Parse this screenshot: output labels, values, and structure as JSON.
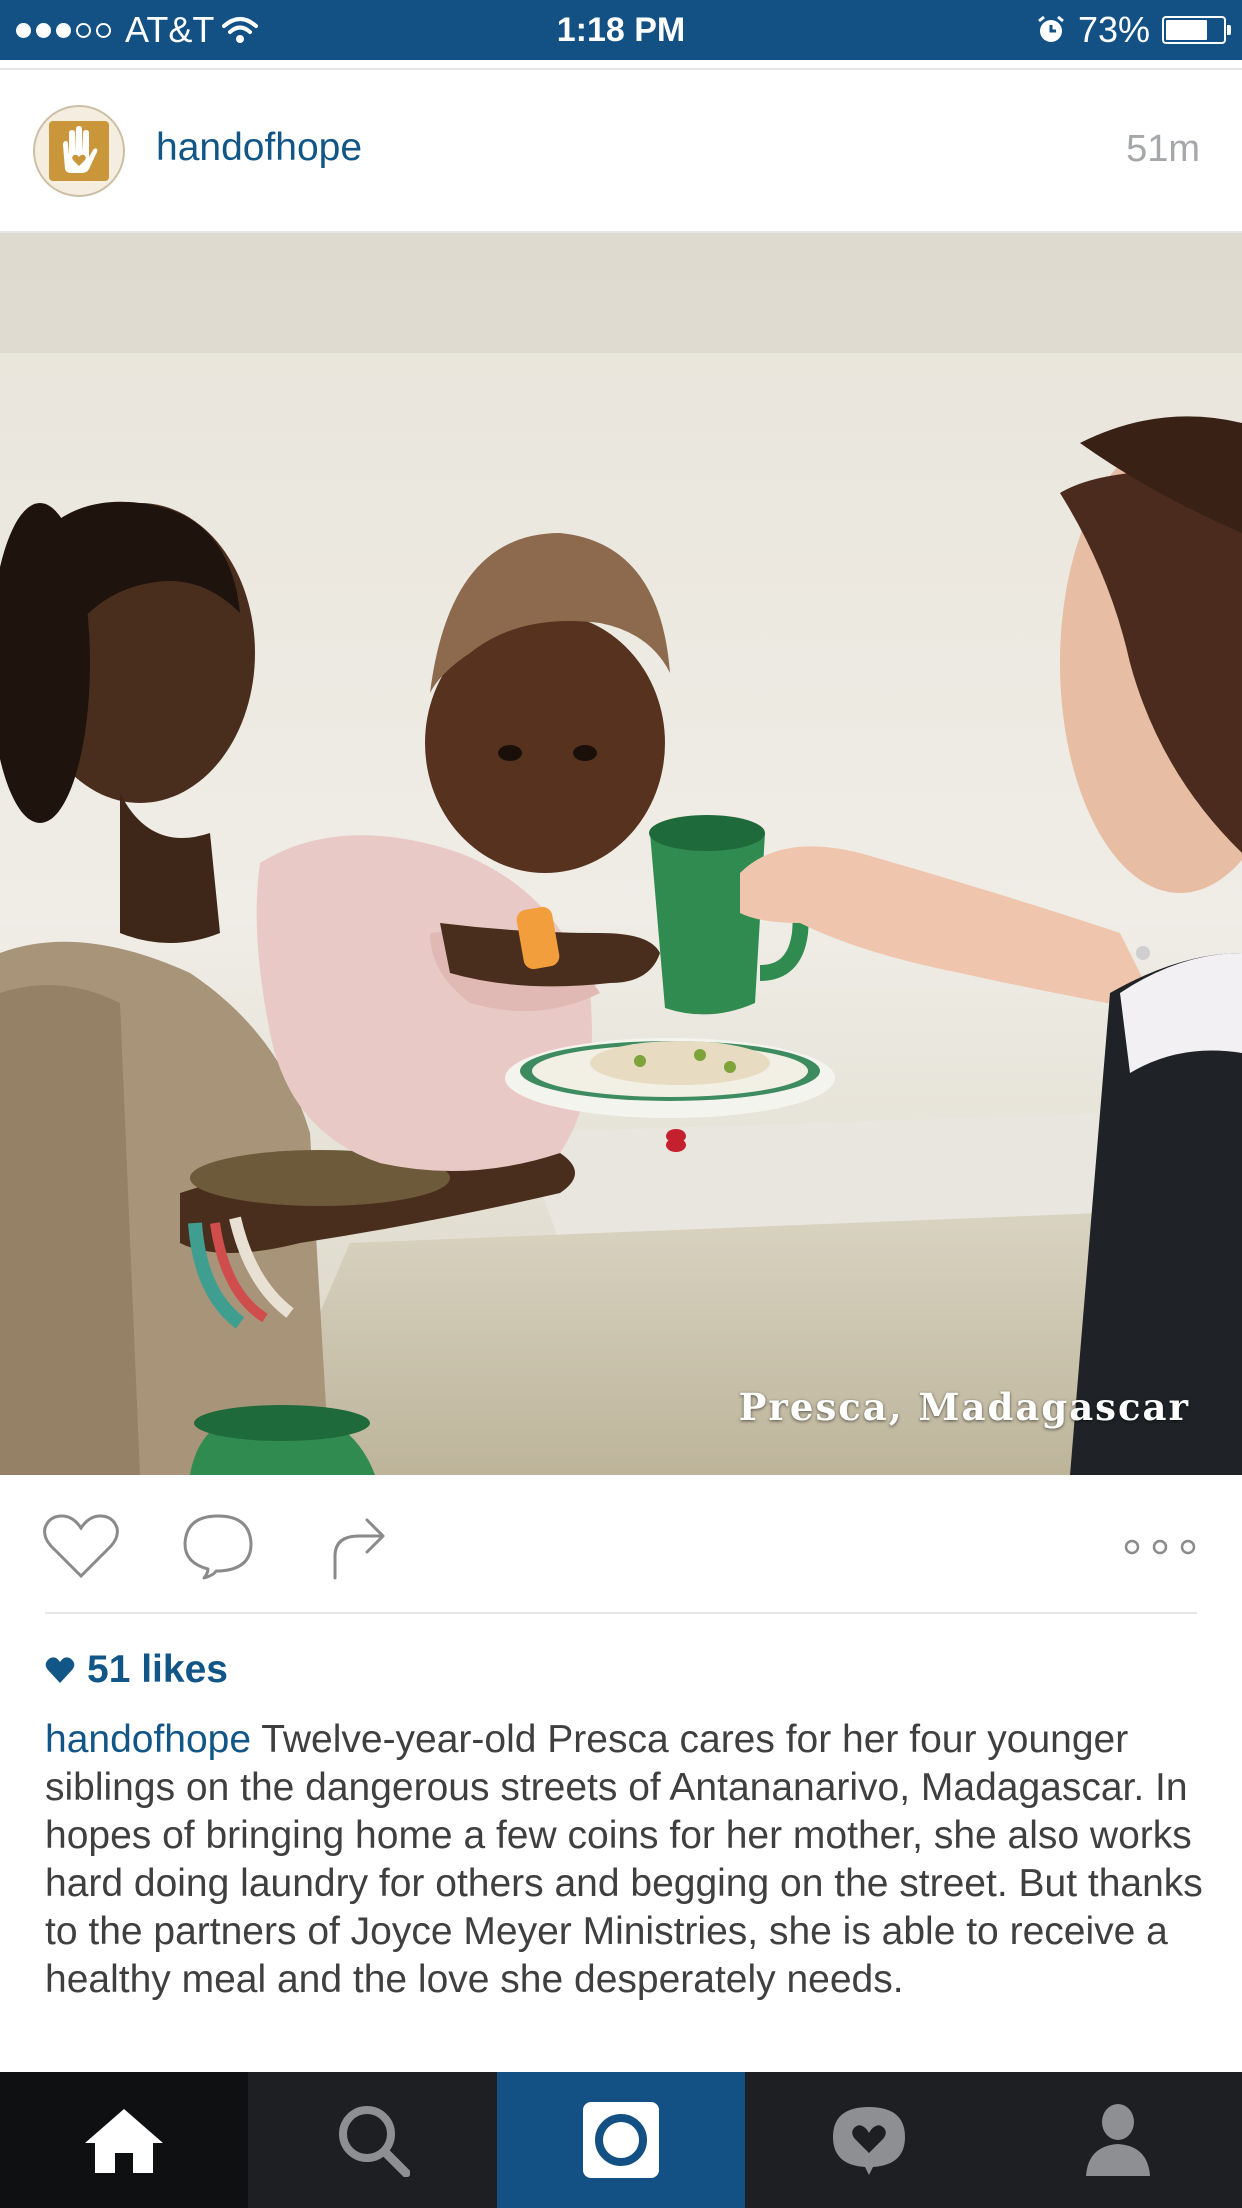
{
  "status_bar": {
    "carrier": "AT&T",
    "time": "1:18 PM",
    "battery_percent_label": "73%",
    "battery_level": 0.73,
    "signal_bars_filled": 3,
    "signal_bars_total": 5
  },
  "post": {
    "username": "handofhope",
    "time_ago": "51m",
    "photo_caption": "Presca, Madagascar",
    "likes_label": "51 likes",
    "caption_username": "handofhope",
    "caption_text": "Twelve-year-old Presca cares for her four younger siblings on the dangerous streets of Antananarivo, Madagascar. In hopes of bringing home a few coins for her mother, she also works hard doing laundry for others and begging on the street. But thanks to the partners of Joyce Meyer Ministries, she is able to receive a healthy meal and the love she desperately needs."
  },
  "colors": {
    "brand_blue": "#135184",
    "link_blue": "#125688",
    "tab_bar": "#1d1f23"
  },
  "icons": {
    "actions": [
      "heart-icon",
      "comment-icon",
      "share-icon",
      "more-icon"
    ],
    "tabs": [
      "home-icon",
      "search-icon",
      "camera-icon",
      "activity-icon",
      "profile-icon"
    ]
  }
}
